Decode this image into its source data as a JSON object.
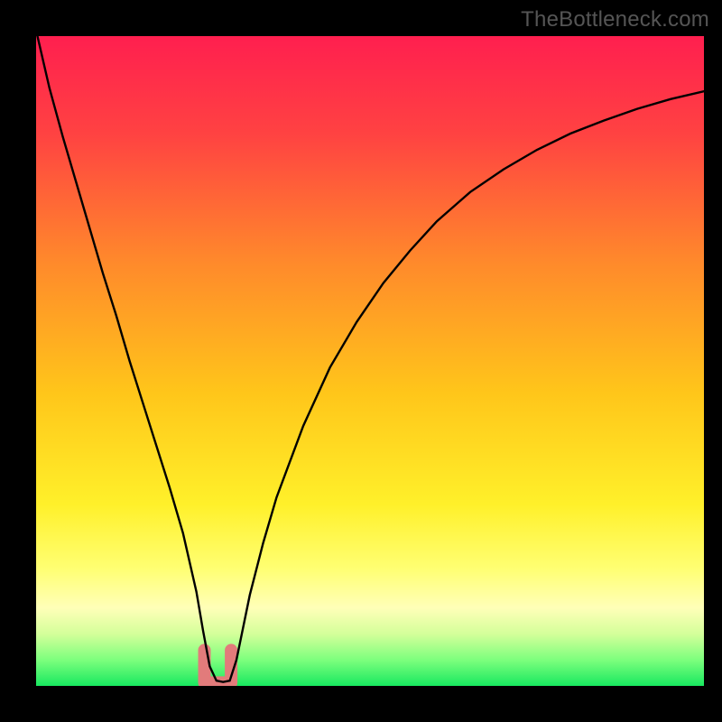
{
  "attribution": "TheBottleneck.com",
  "chart_data": {
    "type": "line",
    "title": "",
    "xlabel": "",
    "ylabel": "",
    "xlim": [
      0,
      100
    ],
    "ylim": [
      0,
      100
    ],
    "series": [
      {
        "name": "bottleneck-curve",
        "x": [
          0.2,
          2,
          4,
          6,
          8,
          10,
          12,
          14,
          16,
          18,
          20,
          22,
          24,
          25,
          26,
          27,
          28,
          29,
          30,
          32,
          34,
          36,
          38,
          40,
          44,
          48,
          52,
          56,
          60,
          65,
          70,
          75,
          80,
          85,
          90,
          95,
          100
        ],
        "values": [
          100,
          92,
          84.5,
          77.5,
          70.5,
          63.5,
          57,
          50,
          43.5,
          37,
          30.5,
          23.5,
          14.5,
          8.5,
          3,
          0.8,
          0.6,
          0.8,
          4,
          14,
          22,
          29,
          34.5,
          40,
          49,
          56,
          62,
          67,
          71.5,
          76,
          79.5,
          82.5,
          85,
          87,
          88.8,
          90.3,
          91.5
        ]
      }
    ],
    "gradient_stops": [
      {
        "offset": 0.0,
        "color": "#ff1f4f"
      },
      {
        "offset": 0.15,
        "color": "#ff4242"
      },
      {
        "offset": 0.35,
        "color": "#ff8a2b"
      },
      {
        "offset": 0.55,
        "color": "#ffc61a"
      },
      {
        "offset": 0.72,
        "color": "#fff02a"
      },
      {
        "offset": 0.82,
        "color": "#ffff73"
      },
      {
        "offset": 0.88,
        "color": "#ffffb8"
      },
      {
        "offset": 0.92,
        "color": "#d4ff9a"
      },
      {
        "offset": 0.96,
        "color": "#7dff7d"
      },
      {
        "offset": 1.0,
        "color": "#18e860"
      }
    ],
    "minimum_marker": {
      "x_start": 25.2,
      "x_end": 29.2,
      "y_floor": 0.5,
      "lobe_height": 5.0,
      "color": "#e27b7b"
    }
  }
}
